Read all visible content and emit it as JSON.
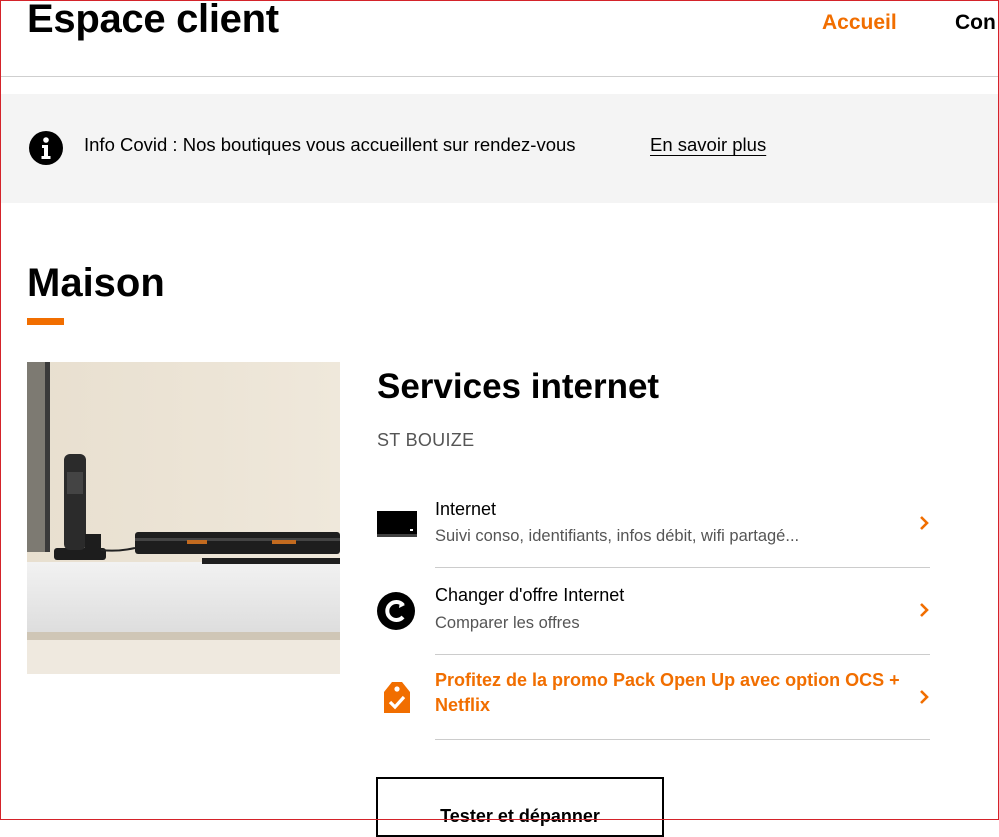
{
  "header": {
    "title": "Espace client",
    "nav": {
      "home": "Accueil",
      "next_partial": "Con"
    }
  },
  "banner": {
    "text": "Info Covid : Nos boutiques vous accueillent sur rendez-vous",
    "link": "En savoir plus",
    "icon": "info-icon"
  },
  "section": {
    "title": "Maison",
    "accent_color": "#f16e00"
  },
  "services": {
    "title": "Services internet",
    "subtitle": "ST BOUIZE",
    "items": [
      {
        "title": "Internet",
        "desc": "Suivi conso, identifiants, infos débit, wifi partagé...",
        "icon": "livebox-icon"
      },
      {
        "title": "Changer d'offre Internet",
        "desc": "Comparer les offres",
        "icon": "change-offer-icon"
      },
      {
        "title": "Profitez de la promo Pack Open Up avec option OCS + Netflix",
        "icon": "promo-tag-icon"
      }
    ],
    "button": "Tester et dépanner"
  }
}
